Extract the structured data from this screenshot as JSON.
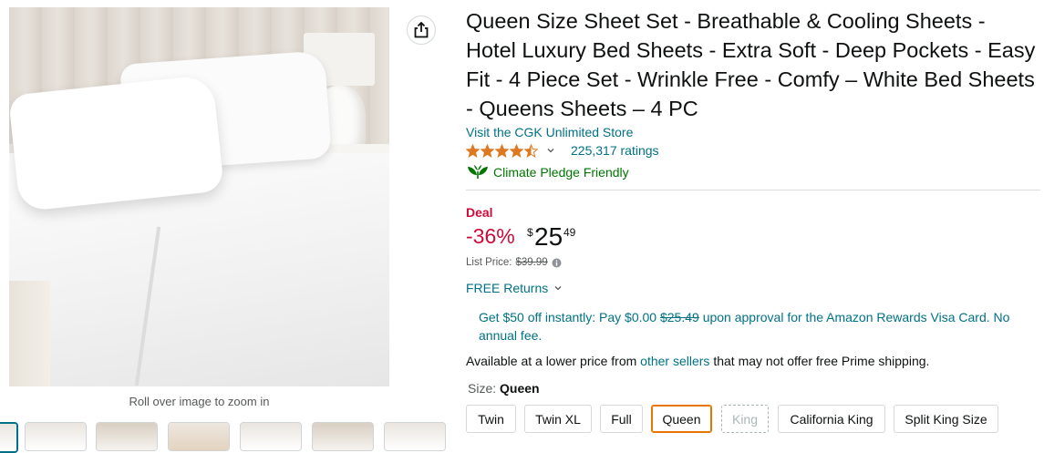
{
  "image_panel": {
    "zoom_hint": "Roll over image to zoom in"
  },
  "product": {
    "title": "Queen Size Sheet Set - Breathable & Cooling Sheets - Hotel Luxury Bed Sheets - Extra Soft - Deep Pockets - Easy Fit - 4 Piece Set - Wrinkle Free - Comfy – White Bed Sheets - Queens Sheets – 4 PC",
    "store_link": "Visit the CGK Unlimited Store",
    "rating_value": 4.5,
    "ratings_count": "225,317 ratings",
    "climate_badge": "Climate Pledge Friendly"
  },
  "pricing": {
    "deal_label": "Deal",
    "discount": "-36%",
    "currency_symbol": "$",
    "price_whole": "25",
    "price_fraction": "49",
    "list_price_label": "List Price:",
    "list_price": "$39.99",
    "free_returns": "FREE Returns"
  },
  "promo": {
    "part1": "Get $50 off instantly: Pay $0.00 ",
    "strike_price": "$25.49",
    "part2": " upon approval for the Amazon Rewards Visa Card. No annual fee."
  },
  "availability": {
    "prefix": "Available at a lower price from ",
    "link": "other sellers",
    "suffix": " that may not offer free Prime shipping."
  },
  "size": {
    "label": "Size:",
    "selected": "Queen",
    "options": [
      "Twin",
      "Twin XL",
      "Full",
      "Queen",
      "King",
      "California King",
      "Split King Size"
    ]
  },
  "colors": {
    "link": "#007185",
    "deal_red": "#cc0c39",
    "climate_green": "#007600",
    "selected_border": "#e77600",
    "star": "#de7921"
  }
}
